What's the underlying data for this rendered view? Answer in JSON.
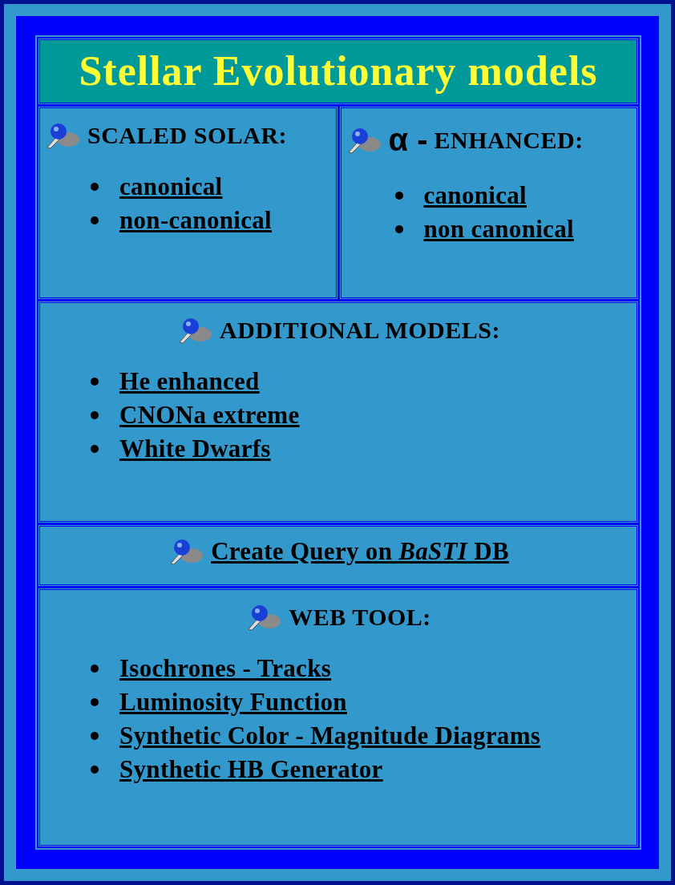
{
  "title": "Stellar Evolutionary models",
  "top_sections": [
    {
      "heading": "SCALED SOLAR:",
      "items": [
        "canonical",
        "non-canonical"
      ]
    },
    {
      "symbol": "α -",
      "heading": "ENHANCED:",
      "items": [
        "canonical",
        "non canonical"
      ]
    }
  ],
  "additional": {
    "heading": "ADDITIONAL MODELS:",
    "items": [
      "He enhanced",
      "CNONa extreme",
      "White Dwarfs"
    ]
  },
  "query": {
    "link": "Create Query on *BaSTI* DB"
  },
  "web_tool": {
    "heading": "WEB TOOL:",
    "items": [
      "Isochrones - Tracks",
      "Luminosity Function",
      "Synthetic Color - Magnitude Diagrams",
      "Synthetic HB Generator"
    ]
  }
}
